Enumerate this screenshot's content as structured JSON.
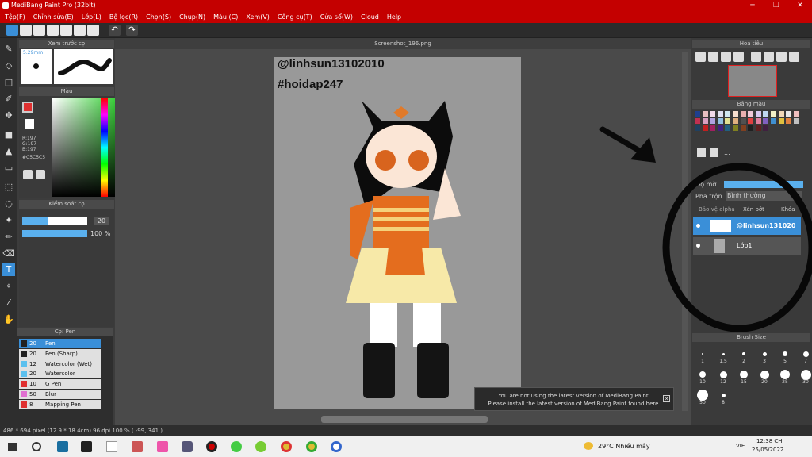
{
  "window": {
    "title": "MediBang Paint Pro (32bit)"
  },
  "menu": [
    "Tệp(F)",
    "Chỉnh sửa(E)",
    "Lớp(L)",
    "Bộ lọc(R)",
    "Chọn(S)",
    "Chụp(N)",
    "Màu (C)",
    "Xem(V)",
    "Công cụ(T)",
    "Cửa sổ(W)",
    "Cloud",
    "Help"
  ],
  "panels": {
    "brush_preview": {
      "title": "Xem trước cọ",
      "size": "5.29mm"
    },
    "color": {
      "title": "Màu",
      "r": "R:197",
      "g": "G:197",
      "b": "B:197",
      "hex": "#C5C5C5"
    },
    "brush_control": {
      "title": "Kiểm soát cọ",
      "size": "20",
      "opacity": "100 %"
    },
    "brush_list": {
      "title": "Cọ: Pen",
      "items": [
        {
          "size": "20",
          "name": "Pen",
          "color": "#222222"
        },
        {
          "size": "20",
          "name": "Pen (Sharp)",
          "color": "#222222"
        },
        {
          "size": "12",
          "name": "Watercolor (Wet)",
          "color": "#5bc0ee"
        },
        {
          "size": "20",
          "name": "Watercolor",
          "color": "#5bc0ee"
        },
        {
          "size": "10",
          "name": "G Pen",
          "color": "#e03030"
        },
        {
          "size": "50",
          "name": "Blur",
          "color": "#e070d0"
        },
        {
          "size": "8",
          "name": "Mapping Pen",
          "color": "#e03030"
        }
      ]
    },
    "navigator": {
      "title": "Hoa tiêu"
    },
    "palette": {
      "title": "Bảng màu",
      "count": "..."
    },
    "layer": {
      "opacity_label": "Độ mờ",
      "blend_label": "Pha trộn",
      "blend_value": "Bình thường",
      "protect_alpha": "Bảo vệ alpha",
      "clipping": "Xén bớt",
      "lock": "Khóa",
      "layers": [
        {
          "name": "@linhsun131020"
        },
        {
          "name": "Lớp1"
        }
      ]
    },
    "brush_size": {
      "title": "Brush Size",
      "sizes": [
        "1",
        "1.5",
        "2",
        "3",
        "5",
        "7",
        "10",
        "12",
        "15",
        "20",
        "25",
        "30",
        "50",
        "8"
      ]
    }
  },
  "canvas": {
    "tab": "Screenshot_196.png",
    "watermark1": "@linhsun13102010",
    "watermark2": "#hoidap247"
  },
  "notice": {
    "line1": "You are not using the latest version of MediBang Paint.",
    "line2": "Please install the latest version of MediBang Paint found here."
  },
  "status": {
    "text": "486 * 694 pixel   (12.9 * 18.4cm)   96 dpi   100 %   ( -99, 341 )"
  },
  "taskbar": {
    "weather": "29°C  Nhiều mây",
    "lang": "VIE",
    "time": "12:38 CH",
    "date": "25/05/2022"
  }
}
